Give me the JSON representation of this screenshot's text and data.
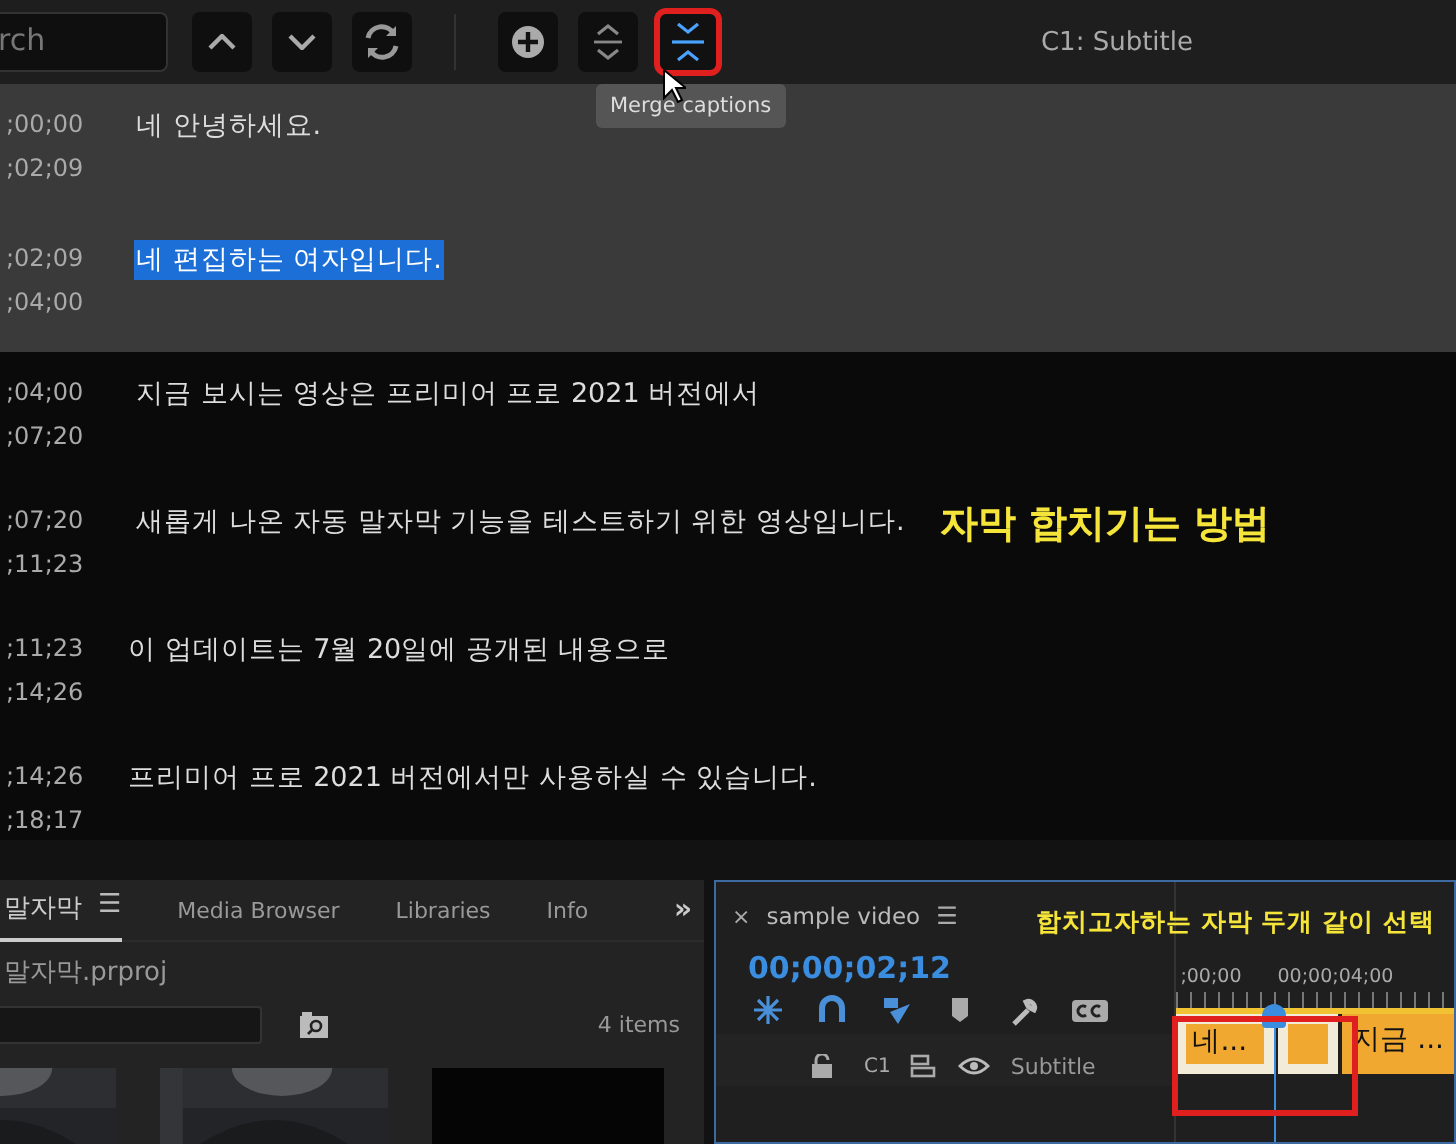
{
  "toolbar": {
    "search_value": "rch",
    "buttons": [
      {
        "kind": "up",
        "highlighted": false
      },
      {
        "kind": "down",
        "highlighted": false
      },
      {
        "kind": "refresh",
        "highlighted": false
      },
      {
        "kind": "divider"
      },
      {
        "kind": "add",
        "highlighted": false
      },
      {
        "kind": "split",
        "highlighted": false
      },
      {
        "kind": "merge",
        "highlighted": true
      }
    ],
    "track_title": "C1: Subtitle"
  },
  "tooltip": "Merge captions",
  "captions": [
    {
      "start": ";00;00",
      "end": ";02;09",
      "text": "네 안녕하세요.",
      "selected": true,
      "text_highlighted": false
    },
    {
      "start": ";02;09",
      "end": ";04;00",
      "text": "네 편집하는 여자입니다.",
      "selected": true,
      "text_highlighted": true
    },
    {
      "start": ";04;00",
      "end": ";07;20",
      "text": "지금 보시는 영상은 프리미어 프로 2021 버전에서",
      "selected": false,
      "text_highlighted": false
    },
    {
      "start": ";07;20",
      "end": ";11;23",
      "text": "새롭게 나온 자동 말자막 기능을 테스트하기 위한 영상입니다.",
      "selected": false,
      "text_highlighted": false
    },
    {
      "start": ";11;23",
      "end": ";14;26",
      "text": "이 업데이트는 7월 20일에 공개된 내용으로",
      "selected": false,
      "text_highlighted": false
    },
    {
      "start": ";14;26",
      "end": ";18;17",
      "text": "프리미어 프로 2021 버전에서만 사용하실 수 있습니다.",
      "selected": false,
      "text_highlighted": false
    }
  ],
  "annotation": "자막 합치기는 방법",
  "project": {
    "tabs": [
      {
        "label": "말자막",
        "selected": true
      },
      {
        "label": "Media Browser",
        "selected": false
      },
      {
        "label": "Libraries",
        "selected": false
      },
      {
        "label": "Info",
        "selected": false
      }
    ],
    "tab_menu": "☰",
    "overflow": "»",
    "file": "말자막.prproj",
    "items_count": "4 items",
    "thumbnails": [
      {
        "kind": "picture"
      },
      {
        "kind": "picture"
      },
      {
        "kind": "caption"
      }
    ]
  },
  "timeline": {
    "close": "×",
    "title": "sample video",
    "menu": "☰",
    "timecode": "00;00;02;12",
    "annotation": "합치고자하는 자막 두개 같이 선택",
    "ruler": [
      ";00;00",
      "00;00;04;00"
    ],
    "tools": [
      {
        "kind": "snap"
      },
      {
        "kind": "magnet"
      },
      {
        "kind": "linked"
      },
      {
        "kind": "marker"
      },
      {
        "kind": "wrench"
      },
      {
        "kind": "cc"
      }
    ],
    "track": {
      "name": "C1",
      "label": "Subtitle",
      "visible": true
    },
    "clips": [
      {
        "text": "네...",
        "selected": true
      },
      {
        "selected": true
      },
      {
        "text": "지금 ...",
        "selected": false
      }
    ]
  }
}
